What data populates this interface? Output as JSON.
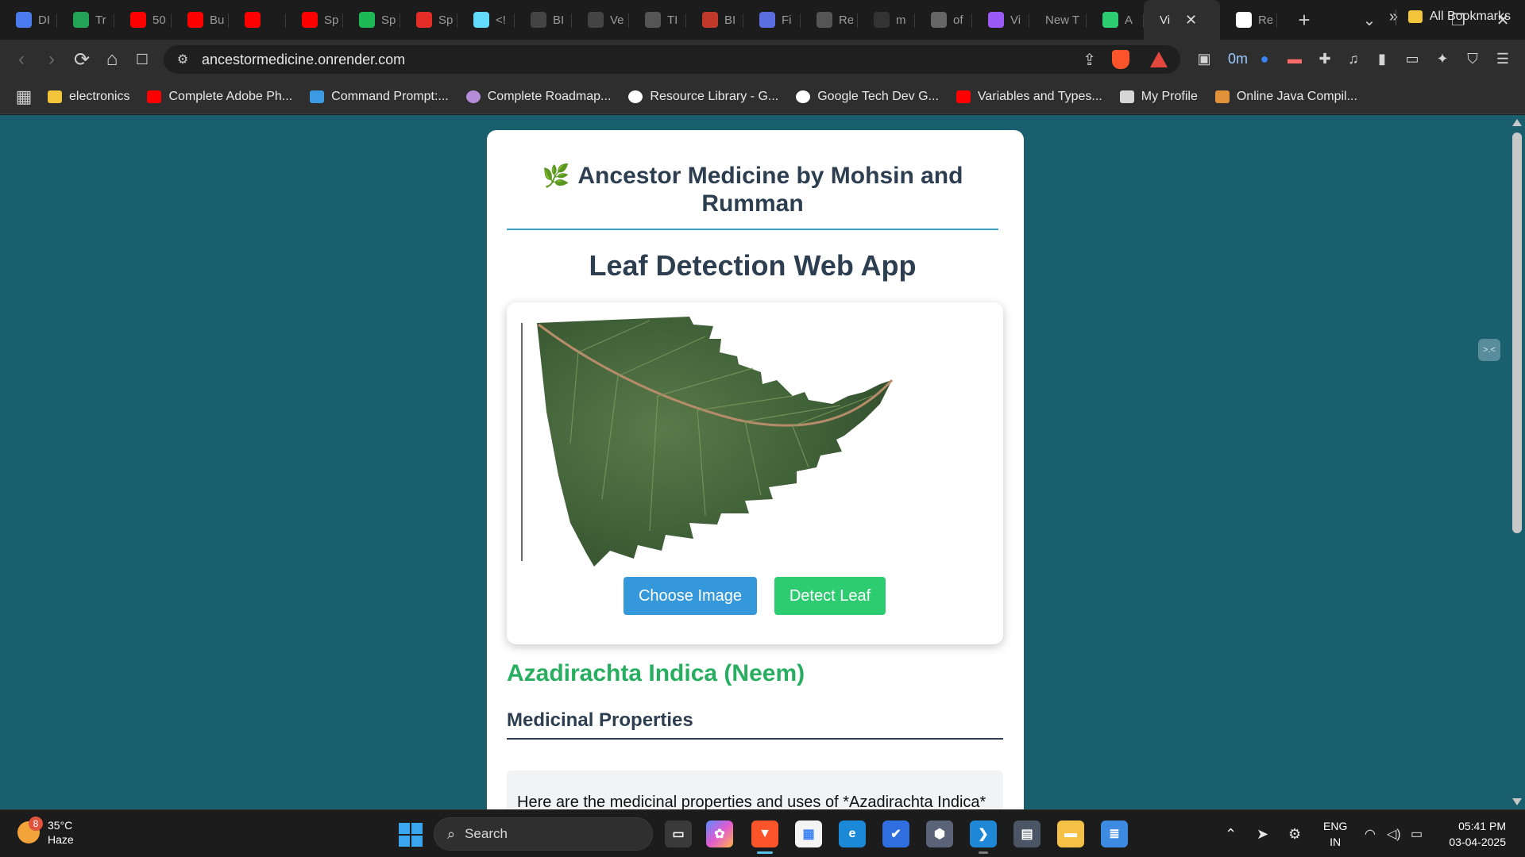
{
  "browser": {
    "tabs": [
      {
        "title": "DI",
        "icon": "docs-icon",
        "color": "#4a7cf0"
      },
      {
        "title": "Tr",
        "icon": "sheets-icon",
        "color": "#22a355"
      },
      {
        "title": "50",
        "icon": "youtube-icon",
        "color": "#ff0000"
      },
      {
        "title": "Bu",
        "icon": "youtube-icon",
        "color": "#ff0000"
      },
      {
        "title": "",
        "icon": "youtube-icon",
        "color": "#ff0000"
      },
      {
        "title": "Sp",
        "icon": "youtube-icon",
        "color": "#ff0000"
      },
      {
        "title": "Sp",
        "icon": "green-app-icon",
        "color": "#1db954"
      },
      {
        "title": "Sp",
        "icon": "v-logo-icon",
        "color": "#e52d27"
      },
      {
        "title": "<!",
        "icon": "react-icon",
        "color": "#61dafb"
      },
      {
        "title": "BI",
        "icon": "tt-icon",
        "color": "#444444"
      },
      {
        "title": "Ve",
        "icon": "ve-icon",
        "color": "#444444"
      },
      {
        "title": "TI",
        "icon": "openai-icon",
        "color": "#555555"
      },
      {
        "title": "BI",
        "icon": "bfe-icon",
        "color": "#c0392b"
      },
      {
        "title": "Fi",
        "icon": "figma-icon",
        "color": "#5b6ee1"
      },
      {
        "title": "Re",
        "icon": "openai-icon",
        "color": "#555555"
      },
      {
        "title": "m",
        "icon": "github-icon",
        "color": "#333333"
      },
      {
        "title": "of",
        "icon": "globe-icon",
        "color": "#666666"
      },
      {
        "title": "Vi",
        "icon": "vite-icon",
        "color": "#9b59f6"
      },
      {
        "title": "New T",
        "icon": "",
        "color": ""
      },
      {
        "title": "A",
        "icon": "render-icon",
        "color": "#2ecc71"
      },
      {
        "title": "Vi",
        "icon": "",
        "color": ""
      },
      {
        "title": "Re",
        "icon": "render-icon",
        "color": "#ffffff"
      }
    ],
    "new_tab_symbol": "+",
    "tab_search_symbol": "⌄",
    "window_controls": {
      "minimize": "─",
      "restore": "❐",
      "close": "✕"
    },
    "tab_close_symbol": "✕",
    "url": "ancestormedicine.onrender.com",
    "nav": {
      "back": "‹",
      "forward": "›",
      "reload": "⟳",
      "home": "⌂",
      "bookmark": "🔖"
    },
    "extensions_badge": "0m",
    "bookmarks": [
      {
        "label": "electronics",
        "icon": "folder-icon",
        "color": "#f3c53a"
      },
      {
        "label": "Complete Adobe Ph...",
        "icon": "youtube-icon",
        "color": "#ff0000"
      },
      {
        "label": "Command Prompt:...",
        "icon": "pin-icon",
        "color": "#3b9ae1"
      },
      {
        "label": "Complete Roadmap...",
        "icon": "avatar-icon",
        "color": "#b48cd8"
      },
      {
        "label": "Resource Library - G...",
        "icon": "google-icon",
        "color": "#ffffff"
      },
      {
        "label": "Google Tech Dev G...",
        "icon": "google-icon",
        "color": "#ffffff"
      },
      {
        "label": "Variables and Types...",
        "icon": "youtube-icon",
        "color": "#ff0000"
      },
      {
        "label": "My Profile",
        "icon": "profile-icon",
        "color": "#d6d6d6"
      },
      {
        "label": "Online Java Compil...",
        "icon": "java-icon",
        "color": "#e0913a"
      }
    ],
    "more_bookmarks": "»",
    "all_bookmarks": "All Bookmarks"
  },
  "page": {
    "brand_icon": "🌿",
    "brand_title": "Ancestor Medicine by Mohsin and Rumman",
    "app_title": "Leaf Detection Web App",
    "choose_button": "Choose Image",
    "detect_button": "Detect Leaf",
    "result_name": "Azadirachta Indica (Neem)",
    "section_heading": "Medicinal Properties",
    "description": "Here are the medicinal properties and uses of *Azadirachta Indica* (Neem) in brief bullet points:",
    "colors": {
      "background": "#1a5f6e",
      "choose": "#3498db",
      "detect": "#2ecc71",
      "result": "#27ae60"
    }
  },
  "taskbar": {
    "weather_badge": "8",
    "temperature": "35°C",
    "condition": "Haze",
    "search_label": "Search",
    "language_top": "ENG",
    "language_bottom": "IN",
    "time": "05:41 PM",
    "date": "03-04-2025"
  }
}
